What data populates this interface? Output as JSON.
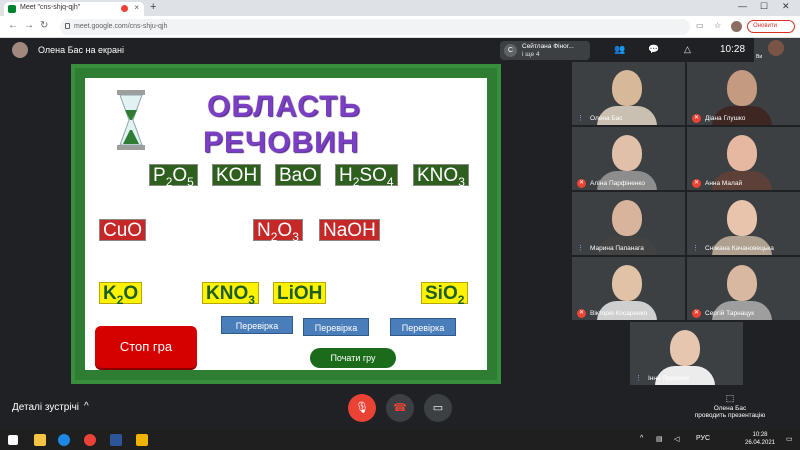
{
  "browser": {
    "tab_title": "Meet \"cns-shjq-qjh\"",
    "new_tab": "+",
    "url": "meet.google.com/cns-shju-qjh",
    "update_label": "Оновити",
    "min": "—",
    "max": "☐",
    "close": "✕"
  },
  "meet": {
    "presenter_label": "Олена Бас на екрані",
    "chip_initial": "С",
    "chip_name": "Сейтлана Фіног...",
    "chip_more": "і ще 4",
    "time": "10:28",
    "self_label": "Ви",
    "details_label": "Деталі зустрічі",
    "presenting_line1": "Олена Бас",
    "presenting_line2": "проводить презентацію"
  },
  "slide": {
    "title_line1": "ОБЛАСТЬ",
    "title_line2": "РЕЧОВИН",
    "stop_label": "Стоп гра",
    "start_label": "Почати гру",
    "check_label": "Перевірка"
  },
  "participants": [
    {
      "name": "Олена Бас",
      "status": "speaking"
    },
    {
      "name": "Діана Глушко",
      "status": "muted"
    },
    {
      "name": "Алїна Парфіненко",
      "status": "muted"
    },
    {
      "name": "Анна Малай",
      "status": "muted"
    },
    {
      "name": "Марина Папанага",
      "status": "speaking"
    },
    {
      "name": "Сніжана Качановецька",
      "status": "speaking"
    },
    {
      "name": "Вікторія Косаренко",
      "status": "muted"
    },
    {
      "name": "Сергій Тарнацук",
      "status": "muted"
    },
    {
      "name": "Інна Ярушняк",
      "status": "speaking"
    }
  ],
  "taskbar": {
    "lang": "РУС",
    "time": "10:28",
    "date": "26.04.2021"
  },
  "colors": {
    "meet_bg": "#202124",
    "red": "#ea4335",
    "title_purple": "#7b3fc4"
  }
}
